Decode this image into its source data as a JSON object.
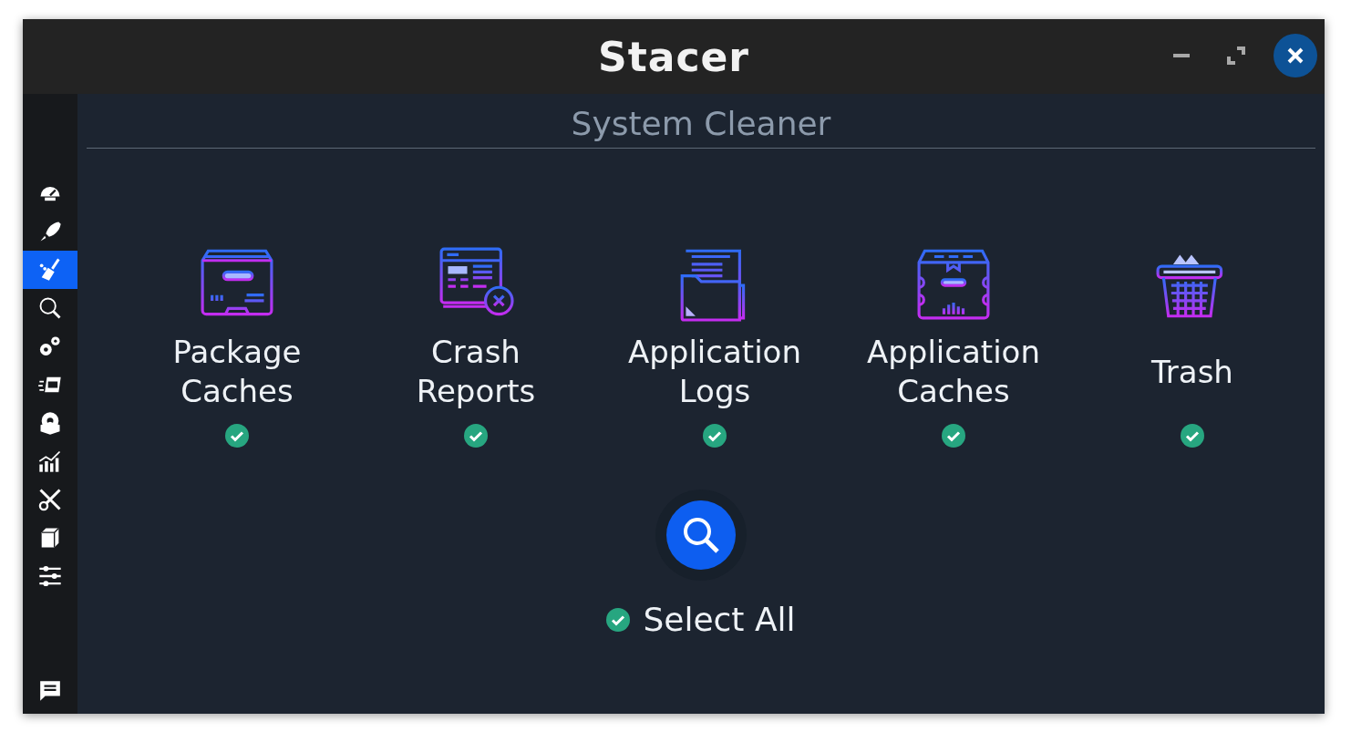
{
  "window": {
    "title": "Stacer"
  },
  "sidebar": {
    "items": [
      {
        "selected": false
      },
      {
        "selected": false
      },
      {
        "selected": true
      },
      {
        "selected": false
      },
      {
        "selected": false
      },
      {
        "selected": false
      },
      {
        "selected": false
      },
      {
        "selected": false
      },
      {
        "selected": false
      },
      {
        "selected": false
      },
      {
        "selected": false
      }
    ]
  },
  "page_title": "System Cleaner",
  "categories": [
    {
      "label": "Package Caches",
      "checked": true
    },
    {
      "label": "Crash Reports",
      "checked": true
    },
    {
      "label": "Application Logs",
      "checked": true
    },
    {
      "label": "Application Caches",
      "checked": true
    },
    {
      "label": "Trash",
      "checked": true
    }
  ],
  "select_all": {
    "label": "Select All",
    "checked": true
  }
}
